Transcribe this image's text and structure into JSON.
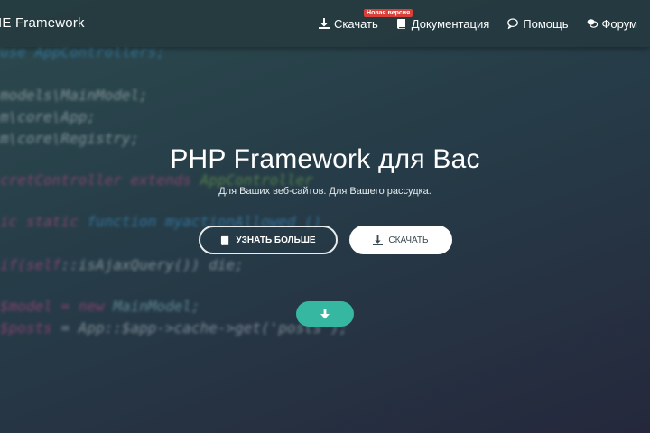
{
  "brand": {
    "title": "IE Framework"
  },
  "nav": {
    "download": {
      "label": "Скачать",
      "badge": "Новая версия",
      "icon": "download-icon"
    },
    "docs": {
      "label": "Документация",
      "icon": "book-icon"
    },
    "help": {
      "label": "Помощь",
      "icon": "speech-bubble-icon"
    },
    "forum": {
      "label": "Форум",
      "icon": "chat-bubbles-icon"
    }
  },
  "hero": {
    "title": "PHP Framework для Вас",
    "subtitle": "Для Ваших веб-сайтов. Для Вашего рассудка.",
    "learn_more": "УЗНАТЬ БОЛЬШЕ",
    "download": "СКАЧАТЬ",
    "scroll_icon": "arrow-down-icon"
  },
  "code_background": {
    "line1": "use AppControllers;",
    "line2": "models\\MainModel;",
    "line3": "m\\core\\App;",
    "line4": "m\\core\\Registry;",
    "line5a": "cretController ",
    "line5b": "extends ",
    "line5c": "AppController",
    "line6a": "ic static ",
    "line6b": "function ",
    "line6c": "myactionAllowed ()",
    "line7a": "if(",
    "line7b": "self",
    "line7c": "::isAjaxQuery()) die;",
    "line8a": "$model ",
    "line8b": "= new ",
    "line8c": "MainModel;",
    "line9a": "$posts ",
    "line9b": "= App::$app->cache->get('posts');"
  },
  "colors": {
    "accent": "#35b7a1",
    "badge": "#d9403a"
  }
}
